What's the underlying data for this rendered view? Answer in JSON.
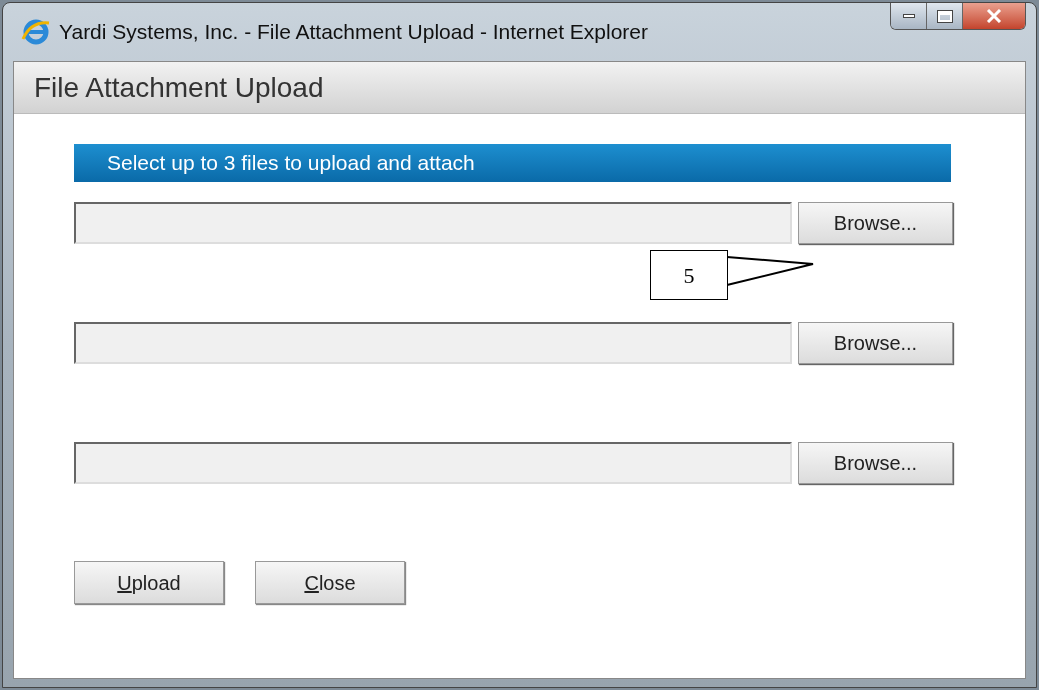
{
  "window": {
    "title": "Yardi Systems, Inc. - File Attachment Upload - Internet Explorer"
  },
  "dialog": {
    "heading": "File Attachment Upload",
    "banner": "Select up to 3 files to upload and attach"
  },
  "files": [
    {
      "button": "Browse..."
    },
    {
      "button": "Browse..."
    },
    {
      "button": "Browse..."
    }
  ],
  "callout": {
    "label": "5"
  },
  "actions": [
    {
      "access_key": "U",
      "rest": "pload"
    },
    {
      "access_key": "C",
      "rest": "lose"
    }
  ]
}
